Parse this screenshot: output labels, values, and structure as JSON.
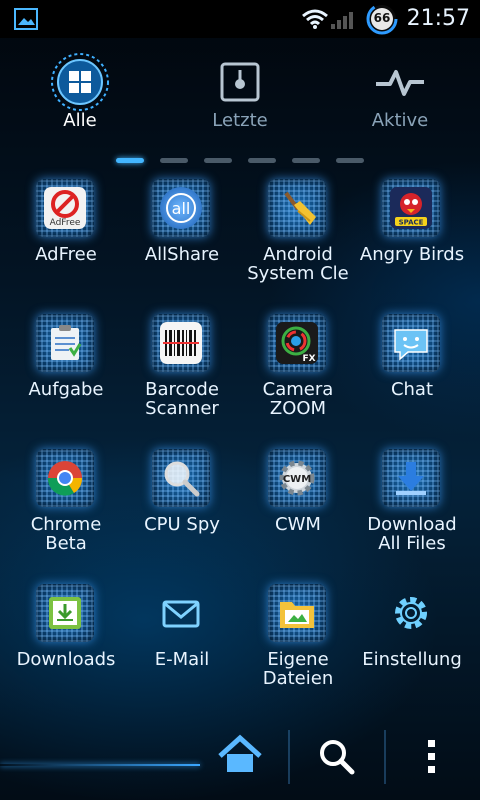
{
  "status": {
    "time": "21:57",
    "battery": "66"
  },
  "tabs": [
    {
      "label": "Alle",
      "icon": "grid-icon"
    },
    {
      "label": "Letzte",
      "icon": "recent-icon"
    },
    {
      "label": "Aktive",
      "icon": "pulse-icon"
    }
  ],
  "pager": {
    "pages": 6,
    "active": 0
  },
  "apps": [
    {
      "label": "AdFree"
    },
    {
      "label": "AllShare"
    },
    {
      "label": "Android System Cle"
    },
    {
      "label": "Angry Birds"
    },
    {
      "label": "Aufgabe"
    },
    {
      "label": "Barcode Scanner"
    },
    {
      "label": "Camera ZOOM"
    },
    {
      "label": "Chat"
    },
    {
      "label": "Chrome Beta"
    },
    {
      "label": "CPU Spy"
    },
    {
      "label": "CWM"
    },
    {
      "label": "Download All Files"
    },
    {
      "label": "Downloads"
    },
    {
      "label": "E-Mail"
    },
    {
      "label": "Eigene Dateien"
    },
    {
      "label": "Einstellung"
    }
  ],
  "icon_text": {
    "adfree": "AdFree",
    "allshare": "all",
    "angry": "SPACE",
    "fx": "FX",
    "cwm": "CWM"
  },
  "dock": [
    {
      "icon": "home-icon"
    },
    {
      "icon": "search-icon"
    },
    {
      "icon": "menu-icon"
    }
  ]
}
